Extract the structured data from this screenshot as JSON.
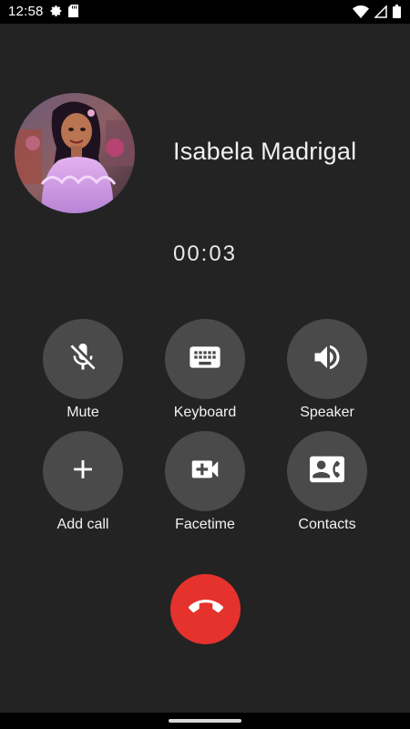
{
  "status_bar": {
    "time": "12:58",
    "left_icons": [
      "gear-icon",
      "sd-card-icon"
    ],
    "right_icons": [
      "wifi-icon",
      "signal-icon",
      "battery-icon"
    ]
  },
  "call": {
    "contact_name": "Isabela Madrigal",
    "timer": "00:03",
    "avatar_icon": "contact-photo"
  },
  "actions": [
    {
      "label": "Mute",
      "icon": "mic-off-icon"
    },
    {
      "label": "Keyboard",
      "icon": "keyboard-icon"
    },
    {
      "label": "Speaker",
      "icon": "speaker-icon"
    },
    {
      "label": "Add call",
      "icon": "plus-icon"
    },
    {
      "label": "Facetime",
      "icon": "video-camera-icon"
    },
    {
      "label": "Contacts",
      "icon": "contacts-icon"
    }
  ],
  "colors": {
    "background": "#232323",
    "action_button": "#4a4a4a",
    "end_call": "#e5322d",
    "status_bar": "#000000"
  }
}
